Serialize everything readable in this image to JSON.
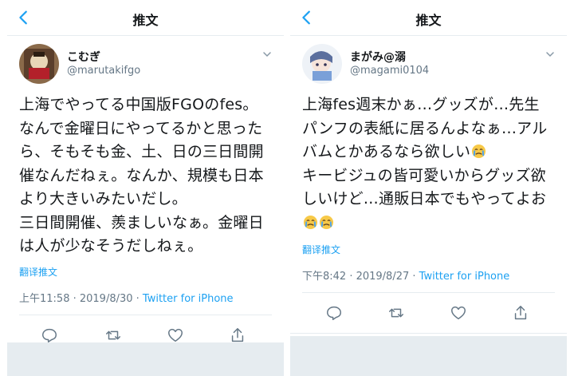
{
  "left": {
    "nav_title": "推文",
    "name": "こむぎ",
    "handle": "@marutakifgo",
    "text": "上海でやってる中国版FGOのfes。なんで金曜日にやってるかと思ったら、そもそも金、土、日の三日間開催なんだねぇ。なんか、規模も日本より大きいみたいだし。\n三日間開催、羨ましいなぁ。金曜日は人が少なそうだしねぇ。",
    "translate": "翻译推文",
    "time": "上午11:58 · 2019/8/30 · ",
    "via": "Twitter for iPhone"
  },
  "right": {
    "nav_title": "推文",
    "name": "まがみ@溺",
    "handle": "@magami0104",
    "text_1": "上海fes週末かぁ…グッズが…先生パンフの表紙に居るんよなぁ…アルバムとかあるなら欲しい",
    "text_2": "キービジュの皆可愛いからグッズ欲しいけど…通販日本でもやってよお",
    "translate": "翻译推文",
    "time": "下午8:42 · 2019/8/27 · ",
    "via": "Twitter for iPhone"
  },
  "icons": {
    "back": "chevron-left-icon",
    "caret": "chevron-down-icon",
    "reply": "reply-icon",
    "retweet": "retweet-icon",
    "like": "heart-icon",
    "share": "share-icon",
    "emoji": "crying-face-emoji"
  },
  "colors": {
    "accent": "#1da1f2",
    "text": "#14171a",
    "muted": "#657786",
    "border": "#e6ecf0"
  }
}
